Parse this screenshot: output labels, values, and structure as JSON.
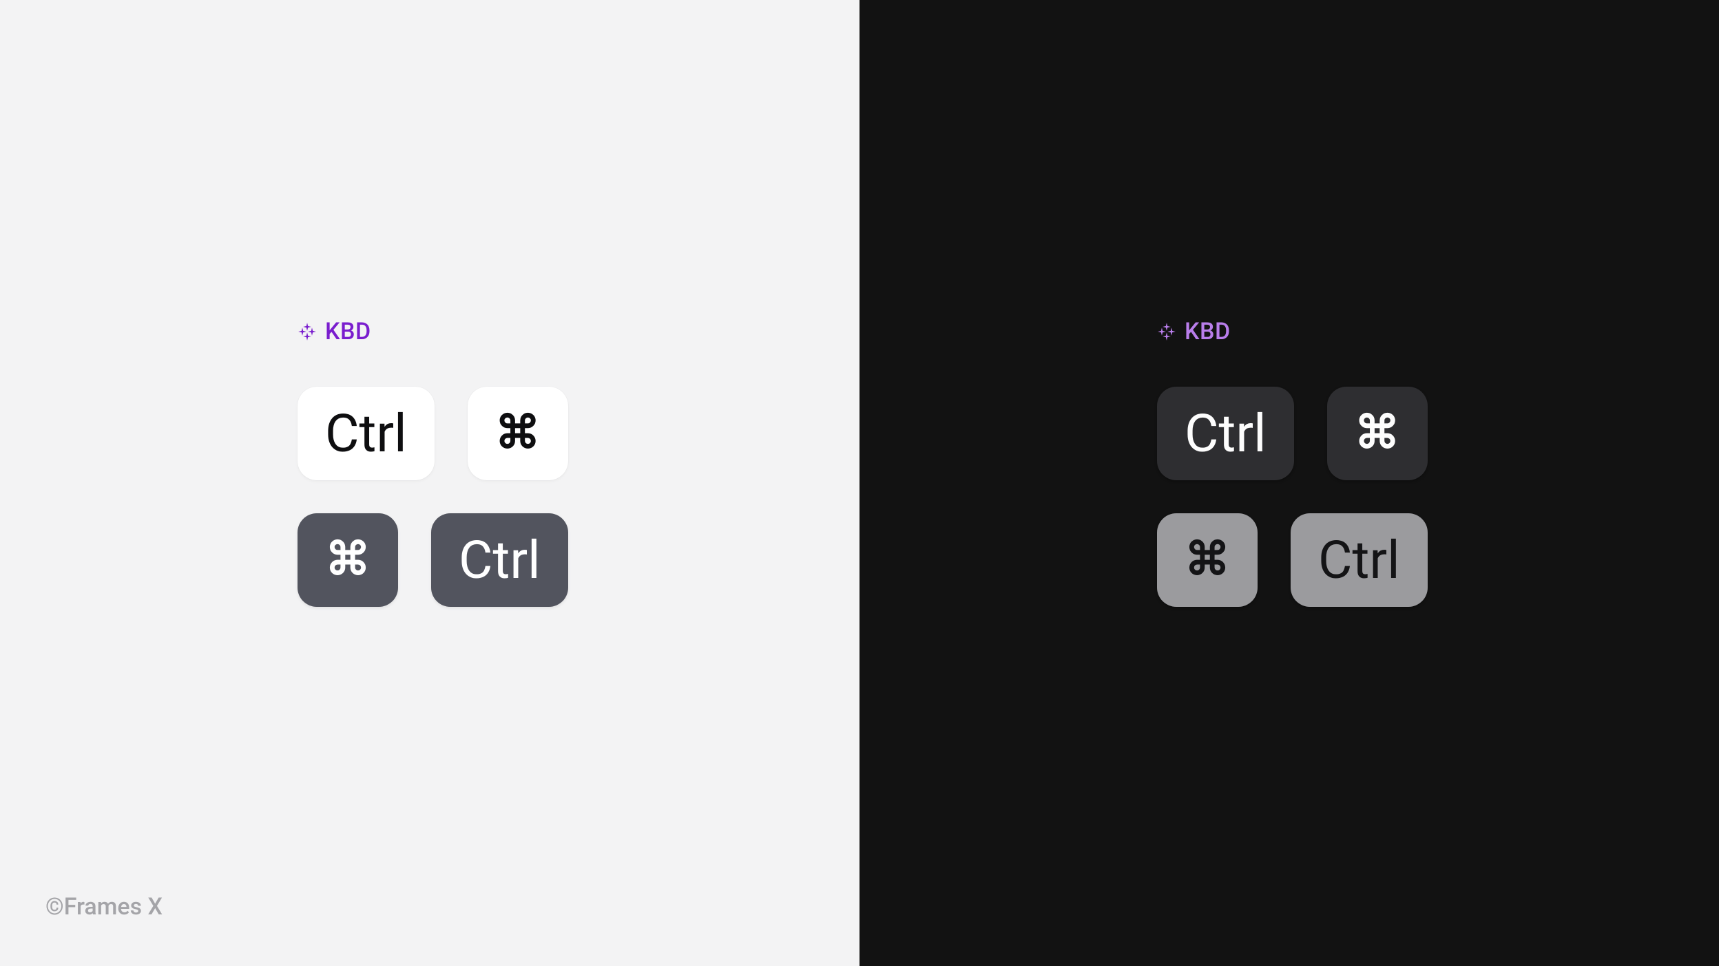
{
  "section_label": "KBD",
  "keys": {
    "ctrl": "Ctrl",
    "cmd": "⌘"
  },
  "footer": "©Frames X",
  "colors": {
    "accent_light": "#7A1DCE",
    "accent_dark": "#B97EEB"
  }
}
